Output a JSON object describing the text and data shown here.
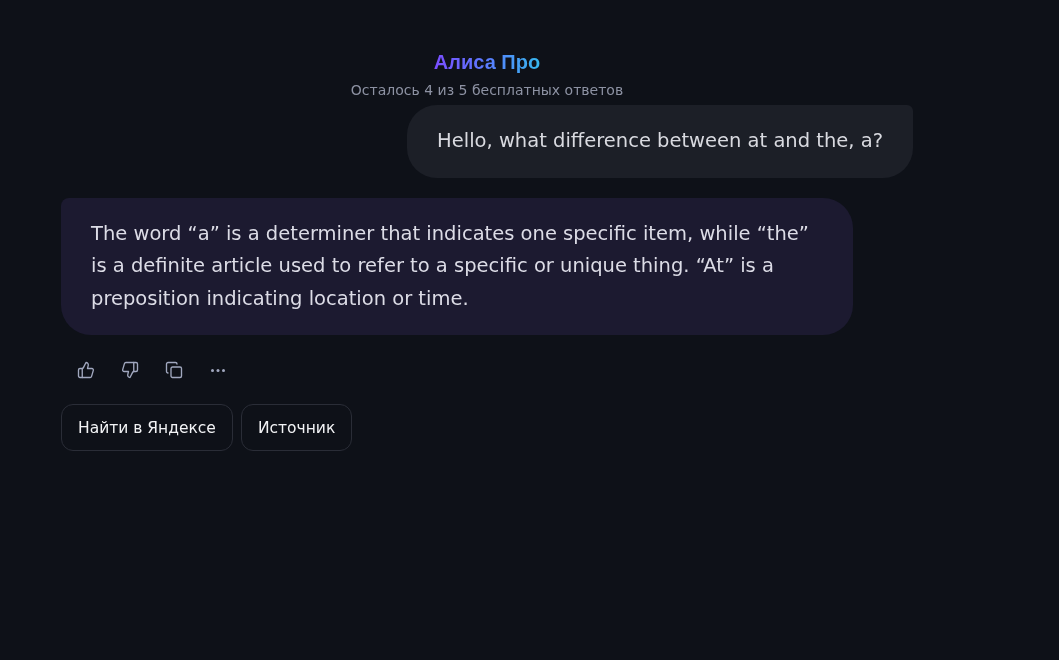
{
  "header": {
    "title": "Алиса Про",
    "subtitle": "Осталось 4 из 5 бесплатных ответов"
  },
  "messages": [
    {
      "kind": "user",
      "text": "Hello, what difference between at and the, a?"
    },
    {
      "kind": "assistant",
      "text": "The word “a” is a determiner that indicates one specific item, while “the” is a definite article used to refer to a specific or unique thing. “At” is a preposition indicating location or time."
    }
  ],
  "suggestions": [
    "Найти в Яндексе",
    "Источник"
  ]
}
